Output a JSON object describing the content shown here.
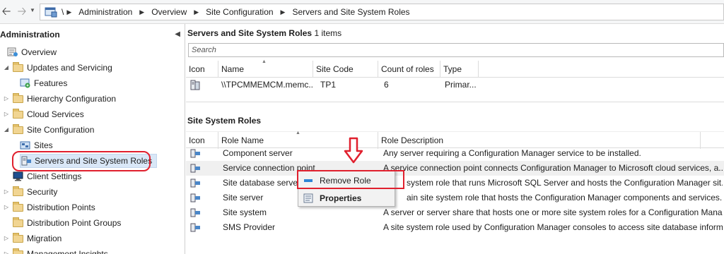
{
  "address_bar": {
    "root": "\\",
    "crumbs": [
      "Administration",
      "Overview",
      "Site Configuration",
      "Servers and Site System Roles"
    ]
  },
  "left_pane": {
    "header": "Administration",
    "items": [
      {
        "label": "Overview"
      },
      {
        "label": "Updates and Servicing"
      },
      {
        "label": "Features"
      },
      {
        "label": "Hierarchy Configuration"
      },
      {
        "label": "Cloud Services"
      },
      {
        "label": "Site Configuration"
      },
      {
        "label": "Sites"
      },
      {
        "label": "Servers and Site System Roles"
      },
      {
        "label": "Client Settings"
      },
      {
        "label": "Security"
      },
      {
        "label": "Distribution Points"
      },
      {
        "label": "Distribution Point Groups"
      },
      {
        "label": "Migration"
      },
      {
        "label": "Management Insights"
      }
    ]
  },
  "servers_section": {
    "title": "Servers and Site System Roles",
    "count": "1 items",
    "search_placeholder": "Search",
    "columns": [
      "Icon",
      "Name",
      "Site Code",
      "Count of roles",
      "Type"
    ],
    "rows": [
      {
        "name": "\\\\TPCMMEMCM.memc...",
        "site_code": "TP1",
        "count": "6",
        "type": "Primar..."
      }
    ]
  },
  "roles_section": {
    "title": "Site System Roles",
    "columns": [
      "Icon",
      "Role Name",
      "Role Description"
    ],
    "rows": [
      {
        "name": "Component server",
        "desc": "Any server requiring a Configuration Manager service to be installed."
      },
      {
        "name": "Service connection point",
        "desc": "A service connection point connects Configuration Manager to Microsoft cloud services, a..."
      },
      {
        "name": "Site database server",
        "desc": "system role that runs Microsoft SQL Server and hosts the Configuration Manager sit..."
      },
      {
        "name": "Site server",
        "desc": "ain site system role that hosts the Configuration Manager components and services."
      },
      {
        "name": "Site system",
        "desc": "A server or server share that hosts one or more site system roles for a Configuration Mana..."
      },
      {
        "name": "SMS Provider",
        "desc": "A site system role used by Configuration Manager consoles to access site database inform..."
      }
    ]
  },
  "context_menu": {
    "items": [
      {
        "label": "Remove Role",
        "icon": "remove-role-icon"
      },
      {
        "label": "Properties",
        "icon": "properties-icon"
      }
    ]
  },
  "colors": {
    "highlight_red": "#e0202e",
    "selection": "#d9e7f7"
  }
}
